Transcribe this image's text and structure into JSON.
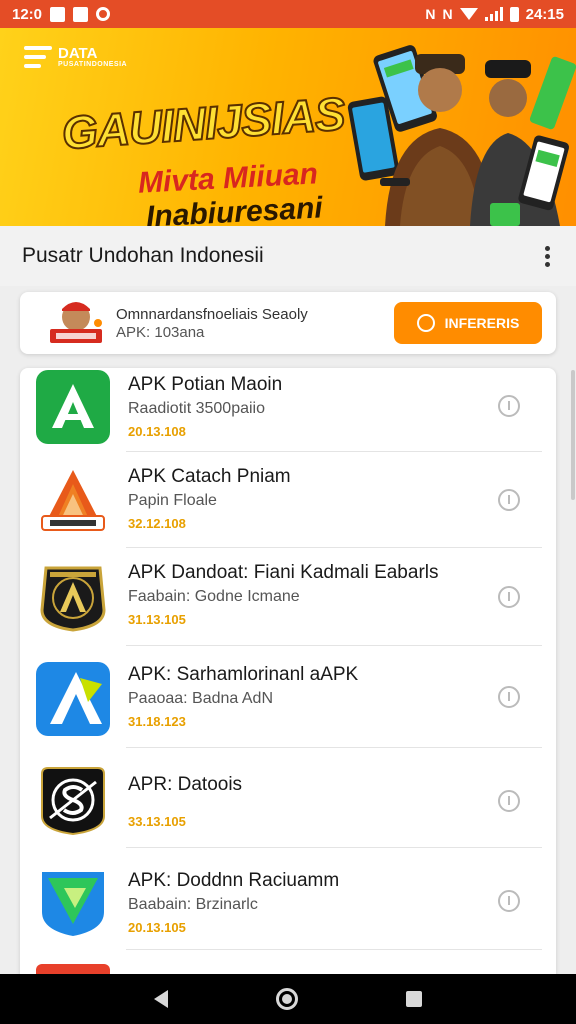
{
  "status_bar": {
    "time_left": "12:0",
    "time_right": "24:15",
    "glyph_a": "N",
    "glyph_b": "N"
  },
  "banner": {
    "logo_title": "DATA",
    "logo_sub": "PUSATINDONESIA",
    "title": "GAUINIJSIAS",
    "subtitle_1": "Mivta Miiuan",
    "subtitle_2": "Inabiuresani"
  },
  "app_bar": {
    "title": "Pusatr Undohan Indonesii"
  },
  "featured": {
    "title": "Omnnardansfnoeliais Seaoly",
    "subtitle": "APK: 103ana",
    "button_label": "INFERERIS"
  },
  "apps": [
    {
      "title": "APK Potian Maoin",
      "subtitle": "Raadiotit 3500paiio",
      "date": "20.13.108",
      "icon": "green-a-icon"
    },
    {
      "title": "APK Catach Pniam",
      "subtitle": "Papin Floale",
      "date": "32.12.108",
      "icon": "orange-a-icon"
    },
    {
      "title": "APK Dandoat: Fiani Kadmali Eabarls",
      "subtitle": "Faabain: Godne Icmane",
      "date": "31.13.105",
      "icon": "black-gold-a-icon"
    },
    {
      "title": "APK: Sarhamlorinanl aAPK",
      "subtitle": "Paaoaa: Badna AdN",
      "date": "31.18.123",
      "icon": "blue-a-icon"
    },
    {
      "title": "APR: Datoois",
      "subtitle": "",
      "date": "33.13.105",
      "icon": "black-s-icon"
    },
    {
      "title": "APK: Doddnn Raciuamm",
      "subtitle": "Baabain: Brzinarlc",
      "date": "20.13.105",
      "icon": "green-triangle-icon"
    }
  ],
  "colors": {
    "status_bar": "#e44d26",
    "accent_orange": "#ff8c00",
    "date_gold": "#e8a000"
  }
}
